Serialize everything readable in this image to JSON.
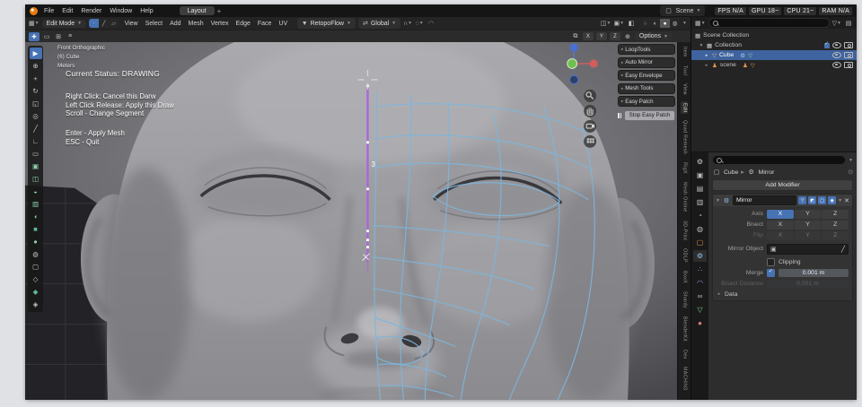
{
  "window": {
    "menus": [
      "File",
      "Edit",
      "Render",
      "Window",
      "Help"
    ],
    "workspace_tab": "Layout",
    "workspace_add": "+",
    "scene_label": "Scene",
    "stats": [
      "FPS N/A",
      "GPU 18~",
      "CPU 21~",
      "RAM N/A"
    ]
  },
  "viewport": {
    "header": {
      "mode_label": "Edit Mode",
      "menus": [
        "View",
        "Select",
        "Add",
        "Mesh",
        "Vertex",
        "Edge",
        "Face",
        "UV"
      ],
      "addon_label": "RetopoFlow",
      "orientation_label": "Global"
    },
    "tools": {
      "axes": [
        "X",
        "Y",
        "Z"
      ],
      "options_label": "Options"
    },
    "overlay": {
      "view_name": "Front Orthographic",
      "object_name": "(6) Cube",
      "units": "Meters",
      "status": "Current Status: DRAWING",
      "hint_1": "Right Click: Cancel this Darw",
      "hint_2": "Left Click Release: Apply this Draw",
      "hint_3": "Scroll - Change Segment",
      "hint_4": "Enter - Apply Mesh",
      "hint_5": "ESC - Quit",
      "segment_count": "3"
    },
    "toolbar": {
      "items": [
        {
          "glyph": "▶",
          "color": "#ffffff",
          "bg": "#4772b3"
        },
        {
          "glyph": "⊕",
          "color": "#c5c5c5",
          "bg": "transparent"
        },
        {
          "glyph": "+",
          "color": "#c5c5c5",
          "bg": "transparent"
        },
        {
          "glyph": "↻",
          "color": "#c5c5c5",
          "bg": "transparent"
        },
        {
          "glyph": "◱",
          "color": "#c5c5c5",
          "bg": "transparent"
        },
        {
          "glyph": "◎",
          "color": "#c5c5c5",
          "bg": "transparent"
        },
        {
          "glyph": "╱",
          "color": "#c5c5c5",
          "bg": "transparent"
        },
        {
          "glyph": "∟",
          "color": "#c5c5c5",
          "bg": "transparent"
        },
        {
          "glyph": "▭",
          "color": "#c5c5c5",
          "bg": "transparent"
        },
        {
          "glyph": "▣",
          "color": "#8fd6b0",
          "bg": "transparent"
        },
        {
          "glyph": "◫",
          "color": "#8fd6b0",
          "bg": "transparent"
        },
        {
          "glyph": "◒",
          "color": "#8fd6b0",
          "bg": "transparent"
        },
        {
          "glyph": "▥",
          "color": "#8fd6b0",
          "bg": "transparent"
        },
        {
          "glyph": "◖",
          "color": "#8fd6b0",
          "bg": "transparent"
        },
        {
          "glyph": "■",
          "color": "#5fb89a",
          "bg": "transparent"
        },
        {
          "glyph": "●",
          "color": "#8fd6b0",
          "bg": "transparent"
        },
        {
          "glyph": "◍",
          "color": "#c5c5c5",
          "bg": "transparent"
        },
        {
          "glyph": "▢",
          "color": "#c5c5c5",
          "bg": "transparent"
        },
        {
          "glyph": "◇",
          "color": "#c5c5c5",
          "bg": "transparent"
        },
        {
          "glyph": "◆",
          "color": "#5fb89a",
          "bg": "transparent"
        },
        {
          "glyph": "◈",
          "color": "#c5c5c5",
          "bg": "transparent"
        }
      ]
    },
    "npanel": {
      "sections": [
        "LoopTools",
        "Auto Mirror",
        "Easy Envelope",
        "Mesh Tools",
        "Easy Patch"
      ],
      "stop_button": "Stop Easy Patch",
      "tabs": [
        {
          "label": "Item",
          "color": "#9a9a9a",
          "bg": "transparent"
        },
        {
          "label": "Tool",
          "color": "#9a9a9a",
          "bg": "transparent"
        },
        {
          "label": "View",
          "color": "#9a9a9a",
          "bg": "transparent"
        },
        {
          "label": "Edit",
          "color": "#e2e2e2",
          "bg": "#2f2f2f"
        },
        {
          "label": "Quad Remesh",
          "color": "#9a9a9a",
          "bg": "transparent"
        },
        {
          "label": "RigX",
          "color": "#9a9a9a",
          "bg": "transparent"
        },
        {
          "label": "Mesh Online",
          "color": "#9a9a9a",
          "bg": "transparent"
        },
        {
          "label": "3D-Print",
          "color": "#9a9a9a",
          "bg": "transparent"
        },
        {
          "label": "ODLP",
          "color": "#9a9a9a",
          "bg": "transparent"
        },
        {
          "label": "BoxX",
          "color": "#9a9a9a",
          "bg": "transparent"
        },
        {
          "label": "Shardy",
          "color": "#9a9a9a",
          "bg": "transparent"
        },
        {
          "label": "BlenderKit",
          "color": "#9a9a9a",
          "bg": "transparent"
        },
        {
          "label": "Dev",
          "color": "#9a9a9a",
          "bg": "transparent"
        },
        {
          "label": "MACHIN3",
          "color": "#9a9a9a",
          "bg": "transparent"
        }
      ]
    }
  },
  "outliner": {
    "scene_collection_label": "Scene Collection",
    "collection_label": "Collection",
    "cube_label": "Cube",
    "armature_label": "scene"
  },
  "properties": {
    "tabs": [
      {
        "glyph": "⚙",
        "color": "#cfcfcf",
        "bg": "transparent"
      },
      {
        "glyph": "▣",
        "color": "#bdbdbd",
        "bg": "transparent"
      },
      {
        "glyph": "▤",
        "color": "#bdbdbd",
        "bg": "transparent"
      },
      {
        "glyph": "▥",
        "color": "#bdbdbd",
        "bg": "transparent"
      },
      {
        "glyph": "◔",
        "color": "#bdbdbd",
        "bg": "transparent"
      },
      {
        "glyph": "◍",
        "color": "#bdbdbd",
        "bg": "transparent"
      },
      {
        "glyph": "▢",
        "color": "#e0954f",
        "bg": "transparent"
      },
      {
        "glyph": "⚙",
        "color": "#8fc1f0",
        "bg": "#2d2d2d"
      },
      {
        "glyph": "∴",
        "color": "#7fa8dc",
        "bg": "transparent"
      },
      {
        "glyph": "◠",
        "color": "#b18fe0",
        "bg": "transparent"
      },
      {
        "glyph": "∞",
        "color": "#bdbdbd",
        "bg": "transparent"
      },
      {
        "glyph": "▽",
        "color": "#7fd49a",
        "bg": "transparent"
      },
      {
        "glyph": "●",
        "color": "#d87f7f",
        "bg": "transparent"
      }
    ],
    "breadcrumb": {
      "object": "Cube",
      "modifier": "Mirror"
    },
    "add_modifier_label": "Add Modifier",
    "mirror": {
      "name": "Mirror",
      "axis_label": "Axis",
      "bisect_label": "Bisect",
      "flip_label": "Flip",
      "axes": [
        "X",
        "Y",
        "Z"
      ],
      "mirror_object_label": "Mirror Object",
      "clipping_label": "Clipping",
      "merge_label": "Merge",
      "merge_value": "0.001 m",
      "bisect_distance_label": "Bisect Distance",
      "bisect_distance_value": "0.001 m",
      "data_label": "Data"
    }
  },
  "colors": {
    "accent": "#4772b3",
    "wireframe": "#7db6dd",
    "symmetry_line": "#a868d8",
    "selection_orange": "#e0954f"
  }
}
